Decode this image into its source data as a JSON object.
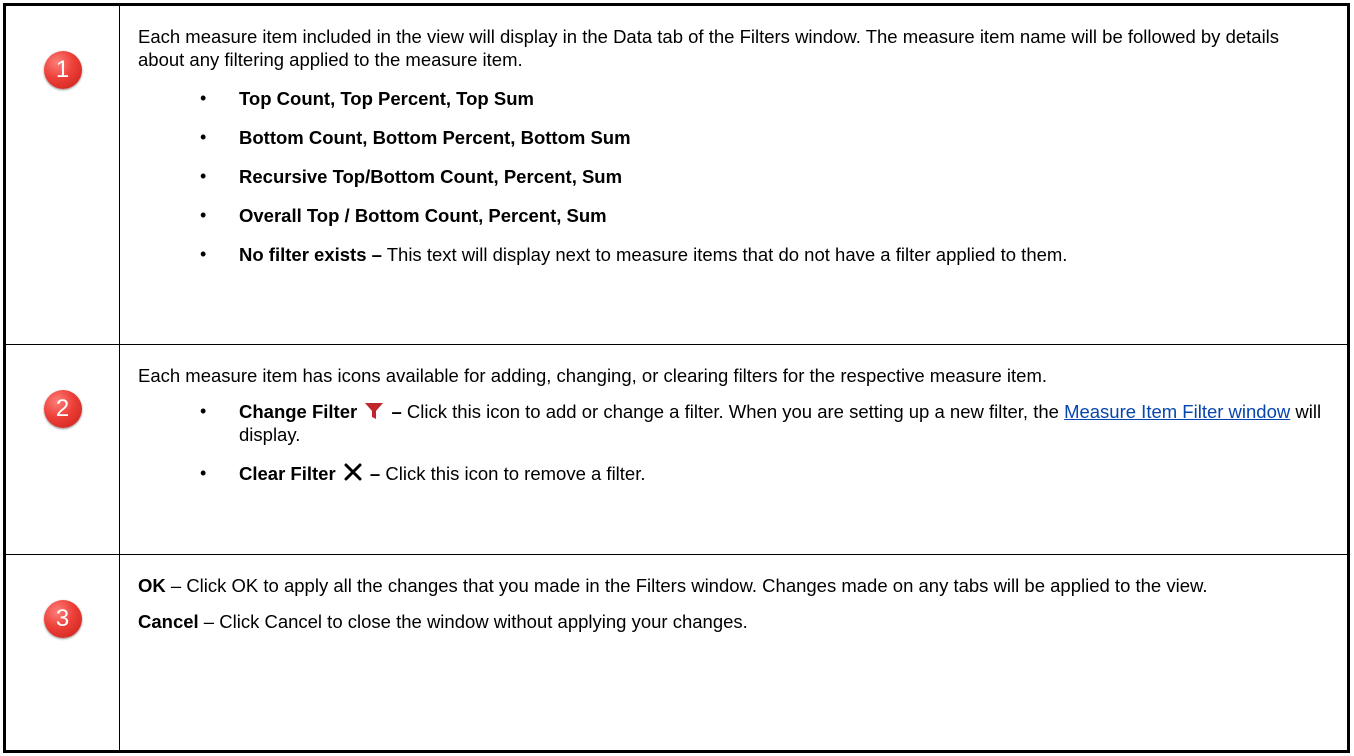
{
  "rows": [
    {
      "number": "1",
      "intro": "Each measure item included in the view will display in the Data tab of the Filters window. The measure item name will be followed by details about any filtering applied to the measure item.",
      "bullets": [
        "Top Count, Top Percent, Top Sum",
        "Bottom Count, Bottom Percent, Bottom Sum",
        "Recursive Top/Bottom Count, Percent, Sum",
        "Overall Top / Bottom Count, Percent, Sum"
      ],
      "last_bullet": {
        "bold": "No filter exists –",
        "text": " This text will display next to measure items that do not have a filter applied to them."
      }
    },
    {
      "number": "2",
      "intro": "Each measure item has icons available for adding, changing, or clearing filters for the respective measure item.",
      "change_filter": {
        "bold": "Change Filter",
        "dash": " –",
        "text_before_link": " Click this icon to add or change a filter. When you are setting up a new filter, the ",
        "link": "Measure Item Filter window",
        "text_after_link": " will display."
      },
      "clear_filter": {
        "bold": "Clear Filter",
        "dash": " –",
        "text": " Click this icon to remove a filter."
      }
    },
    {
      "number": "3",
      "ok": {
        "bold": "OK",
        "text": " – Click OK to apply all the changes that you made in the Filters window. Changes made on any tabs will be applied to the view."
      },
      "cancel": {
        "bold": "Cancel",
        "text": " – Click Cancel to close the window without applying your changes."
      }
    }
  ],
  "icons": {
    "funnel": "funnel-icon",
    "funnel_color": "#c0272d",
    "close": "close-icon"
  },
  "colors": {
    "badge": "#e8403a",
    "link": "#0645ad"
  }
}
